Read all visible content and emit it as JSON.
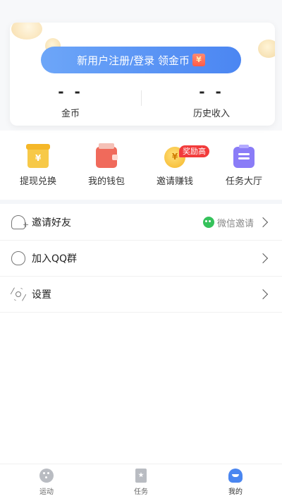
{
  "account_card": {
    "login_button_label": "新用户注册/登录 领金币",
    "stats": [
      {
        "value": "- -",
        "label": "金币"
      },
      {
        "value": "- -",
        "label": "历史收入"
      }
    ]
  },
  "quick_actions": {
    "items": [
      {
        "label": "提现兑换",
        "icon": "coin-exchange-icon"
      },
      {
        "label": "我的钱包",
        "icon": "wallet-icon"
      },
      {
        "label": "邀请赚钱",
        "icon": "invite-coin-icon"
      },
      {
        "label": "任务大厅",
        "icon": "task-list-icon"
      }
    ],
    "badge": "奖励高"
  },
  "menu": {
    "items": [
      {
        "label": "邀请好友",
        "icon": "add-user-icon",
        "extra_label": "微信邀请",
        "extra_icon": "wechat-icon"
      },
      {
        "label": "加入QQ群",
        "icon": "qq-icon"
      },
      {
        "label": "设置",
        "icon": "settings-gear-icon"
      }
    ]
  },
  "tabbar": {
    "items": [
      {
        "label": "运动",
        "icon": "sport-icon",
        "active": false
      },
      {
        "label": "任务",
        "icon": "task-bookmark-icon",
        "active": false
      },
      {
        "label": "我的",
        "icon": "profile-icon",
        "active": true
      }
    ]
  },
  "colors": {
    "accent_blue": "#4b86f2",
    "badge_red": "#f23b3b",
    "wechat_green": "#35c25b"
  }
}
